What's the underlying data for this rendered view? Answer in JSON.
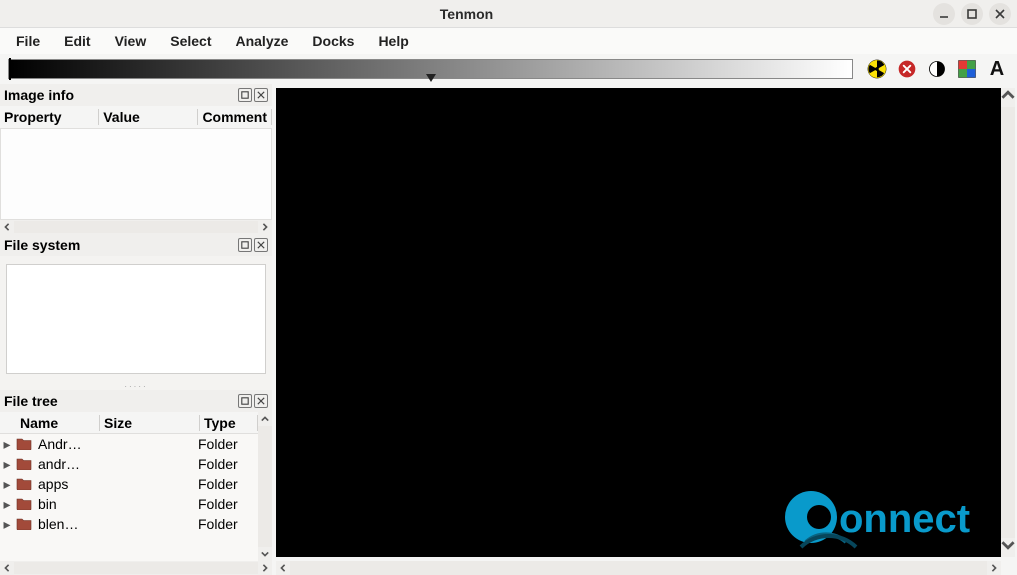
{
  "window": {
    "title": "Tenmon"
  },
  "menu": [
    "File",
    "Edit",
    "View",
    "Select",
    "Analyze",
    "Docks",
    "Help"
  ],
  "panels": {
    "image_info": {
      "title": "Image info",
      "columns": [
        "Property",
        "Value",
        "Comment"
      ]
    },
    "file_system": {
      "title": "File system"
    },
    "file_tree": {
      "title": "File tree",
      "columns": [
        "Name",
        "Size",
        "Type"
      ],
      "rows": [
        {
          "name": "Andr…",
          "size": "",
          "type": "Folder"
        },
        {
          "name": "andr…",
          "size": "",
          "type": "Folder"
        },
        {
          "name": "apps",
          "size": "",
          "type": "Folder"
        },
        {
          "name": "bin",
          "size": "",
          "type": "Folder"
        },
        {
          "name": "blen…",
          "size": "",
          "type": "Folder"
        }
      ]
    }
  },
  "watermark": {
    "text": "onnect"
  }
}
